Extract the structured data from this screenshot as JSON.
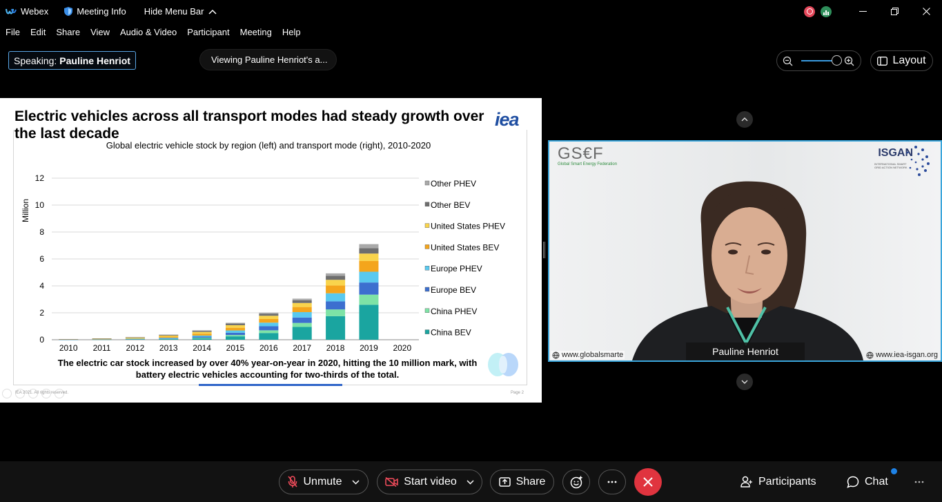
{
  "titlebar": {
    "app_name": "Webex",
    "meeting_info": "Meeting Info",
    "hide_menu": "Hide Menu Bar"
  },
  "menu": [
    "File",
    "Edit",
    "Share",
    "View",
    "Audio & Video",
    "Participant",
    "Meeting",
    "Help"
  ],
  "status": {
    "speaking_label": "Speaking:",
    "speaking_name": "Pauline Henriot",
    "viewing": "Viewing Pauline Henriot's a..."
  },
  "layout_label": "Layout",
  "slide": {
    "title": "Electric vehicles across all transport modes had steady growth over the last decade",
    "logo_text": "iea",
    "caption": "The electric car stock increased by over 40% year-on-year in 2020, hitting the 10 million mark, with battery electric vehicles accounting for two-thirds of the total.",
    "footer_left": "IEA 2021. All rights reserved.",
    "footer_right": "Page 2"
  },
  "chart_data": {
    "type": "bar",
    "stacked": true,
    "title": "Global electric vehicle stock by region (left) and transport mode (right), 2010-2020",
    "ylabel": "Million",
    "ylim": [
      0,
      12
    ],
    "yticks": [
      0,
      2,
      4,
      6,
      8,
      10,
      12
    ],
    "grid": true,
    "legend_position": "right",
    "categories": [
      "2010",
      "2011",
      "2012",
      "2013",
      "2014",
      "2015",
      "2016",
      "2017",
      "2018",
      "2019",
      "2020"
    ],
    "series": [
      {
        "name": "China BEV",
        "color": "#1aa5a0",
        "values": [
          0.01,
          0.02,
          0.03,
          0.05,
          0.1,
          0.25,
          0.5,
          0.95,
          1.75,
          2.6,
          0
        ]
      },
      {
        "name": "China PHEV",
        "color": "#7ee3a6",
        "values": [
          0.0,
          0.0,
          0.01,
          0.02,
          0.05,
          0.1,
          0.2,
          0.3,
          0.5,
          0.75,
          0
        ]
      },
      {
        "name": "Europe BEV",
        "color": "#3c6fcf",
        "values": [
          0.01,
          0.01,
          0.02,
          0.04,
          0.08,
          0.17,
          0.3,
          0.4,
          0.6,
          0.9,
          0
        ]
      },
      {
        "name": "Europe PHEV",
        "color": "#59c9ef",
        "values": [
          0.0,
          0.01,
          0.02,
          0.04,
          0.08,
          0.17,
          0.27,
          0.4,
          0.6,
          0.8,
          0
        ]
      },
      {
        "name": "United States BEV",
        "color": "#f4a51c",
        "values": [
          0.01,
          0.02,
          0.04,
          0.08,
          0.14,
          0.2,
          0.27,
          0.38,
          0.58,
          0.8,
          0
        ]
      },
      {
        "name": "United States PHEV",
        "color": "#f9d44c",
        "values": [
          0.0,
          0.02,
          0.04,
          0.08,
          0.13,
          0.19,
          0.24,
          0.3,
          0.42,
          0.55,
          0
        ]
      },
      {
        "name": "Other BEV",
        "color": "#6e6e6e",
        "values": [
          0.01,
          0.02,
          0.03,
          0.05,
          0.08,
          0.12,
          0.15,
          0.2,
          0.3,
          0.4,
          0
        ]
      },
      {
        "name": "Other PHEV",
        "color": "#a9a9a9",
        "values": [
          0.0,
          0.0,
          0.01,
          0.02,
          0.04,
          0.06,
          0.08,
          0.12,
          0.18,
          0.3,
          0
        ]
      }
    ]
  },
  "video": {
    "participant_name": "Pauline Henriot",
    "logo_left": "GS€F",
    "logo_left_sub": "Global Smart Energy Federation",
    "logo_right": "ISGAN",
    "logo_right_sub": "INTERNATIONAL SMART GRID ACTION NETWORK",
    "url_left": "www.globalsmarte",
    "url_right": "www.iea-isgan.org"
  },
  "controls": {
    "unmute": "Unmute",
    "start_video": "Start video",
    "share": "Share",
    "participants": "Participants",
    "chat": "Chat"
  }
}
